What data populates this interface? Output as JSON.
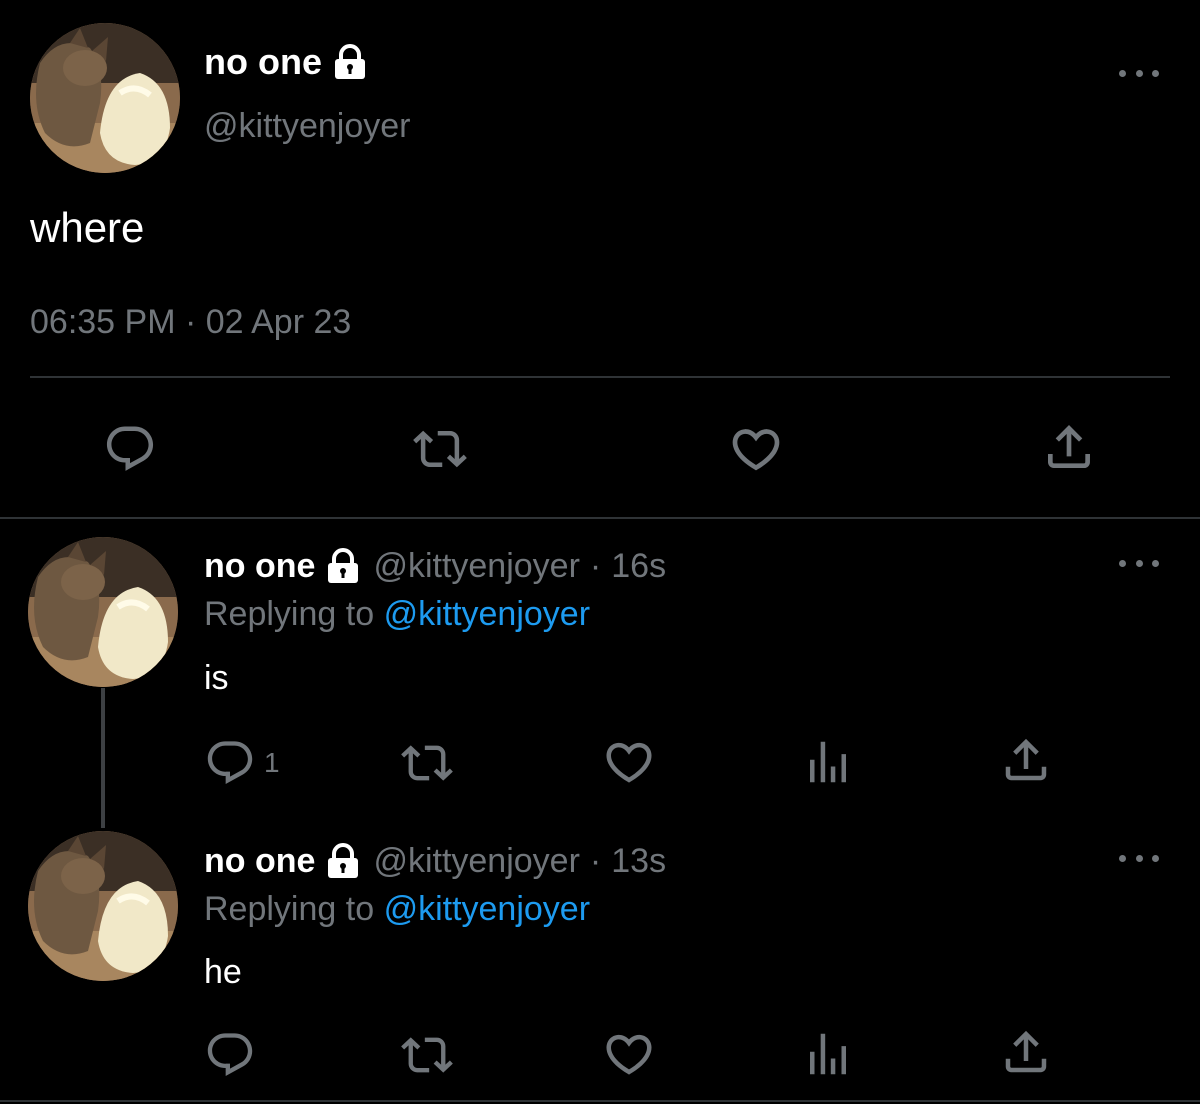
{
  "main_tweet": {
    "display_name": "no one",
    "handle": "@kittyenjoyer",
    "text": "where",
    "timestamp": "06:35 PM · 02 Apr 23",
    "avatar_icon": "cat-avatar",
    "lock_icon": "lock-icon",
    "actions": [
      "reply-icon",
      "retweet-icon",
      "like-icon",
      "share-icon"
    ]
  },
  "replies": [
    {
      "display_name": "no one",
      "handle": "@kittyenjoyer",
      "separator": "·",
      "age": "16s",
      "replying_label": "Replying to",
      "replying_to": "@kittyenjoyer",
      "text": "is",
      "reply_count": "1",
      "actions": [
        "reply-icon",
        "retweet-icon",
        "like-icon",
        "views-icon",
        "share-icon"
      ]
    },
    {
      "display_name": "no one",
      "handle": "@kittyenjoyer",
      "separator": "·",
      "age": "13s",
      "replying_label": "Replying to",
      "replying_to": "@kittyenjoyer",
      "text": "he",
      "reply_count": "",
      "actions": [
        "reply-icon",
        "retweet-icon",
        "like-icon",
        "views-icon",
        "share-icon"
      ]
    }
  ],
  "colors": {
    "background": "#000000",
    "text_primary": "#ffffff",
    "text_secondary": "#71767b",
    "link": "#1d9bf0",
    "divider": "#2f3336"
  }
}
